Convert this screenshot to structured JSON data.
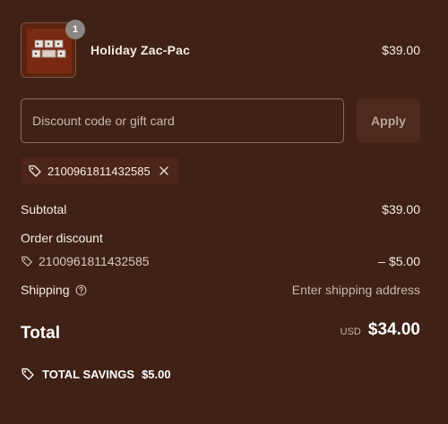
{
  "product": {
    "name": "Holiday Zac-Pac",
    "price": "$39.00",
    "quantity": "1",
    "image_icon": "product-thumbnail"
  },
  "discount": {
    "placeholder": "Discount code or gift card",
    "apply_label": "Apply",
    "applied_code": "2100961811432585"
  },
  "totals": {
    "subtotal_label": "Subtotal",
    "subtotal_value": "$39.00",
    "order_discount_label": "Order discount",
    "discount_code": "2100961811432585",
    "discount_value": "– $5.00",
    "shipping_label": "Shipping",
    "shipping_value": "Enter shipping address",
    "total_label": "Total",
    "currency": "USD",
    "total_value": "$34.00"
  },
  "savings": {
    "label": "TOTAL SAVINGS",
    "amount": "$5.00"
  },
  "colors": {
    "background": "#3f2115",
    "panel": "#4c2618",
    "text": "#f5ece4",
    "muted": "#c9b8ae"
  }
}
